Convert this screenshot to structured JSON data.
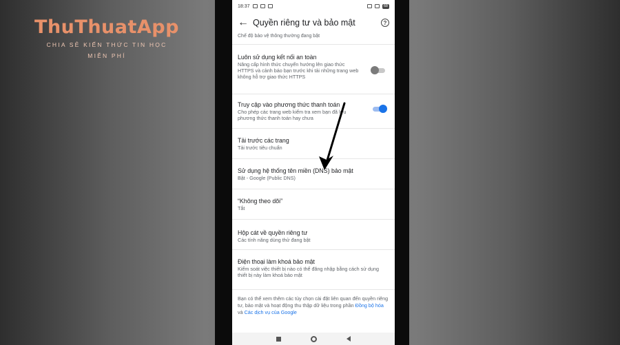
{
  "watermark": {
    "logo": "ThuThuatApp",
    "tagline_line1": "CHIA SẺ KIẾN THỨC TIN HỌC",
    "tagline_line2": "MIỄN PHÍ"
  },
  "statusbar": {
    "time": "18:37",
    "battery": "68"
  },
  "appbar": {
    "title": "Quyền riêng tư và bảo mật"
  },
  "settings": {
    "partial_top": "Chế độ bảo vệ thông thường đang bật",
    "items": [
      {
        "title": "Luôn sử dụng kết nối an toàn",
        "subtitle": "Nâng cấp hình thức chuyển hướng lên giao thức HTTPS và cảnh báo bạn trước khi tải những trang web không hỗ trợ giao thức HTTPS",
        "toggle": "off"
      },
      {
        "title": "Truy cập vào phương thức thanh toán",
        "subtitle": "Cho phép các trang web kiểm tra xem bạn đã lưu phương thức thanh toán hay chưa",
        "toggle": "on"
      },
      {
        "title": "Tải trước các trang",
        "subtitle": "Tải trước tiêu chuẩn"
      },
      {
        "title": "Sử dụng hệ thống tên miền (DNS) bảo mật",
        "subtitle": "Bật - Google (Public DNS)"
      },
      {
        "title": "“Không theo dõi”",
        "subtitle": "Tắt"
      },
      {
        "title": "Hộp cát về quyền riêng tư",
        "subtitle": "Các tính năng dùng thử đang bật"
      },
      {
        "title": "Điện thoại làm khoá bảo mật",
        "subtitle": "Kiểm soát việc thiết bị nào có thể đăng nhập bằng cách sử dụng thiết bị này làm khoá bảo mật"
      }
    ],
    "footer_note": {
      "text": "Bạn có thể xem thêm các tùy chọn cài đặt liên quan đến quyền riêng tư, bảo mật và hoạt động thu thập dữ liệu trong phần ",
      "link1": "Đồng bộ hóa",
      "between": " và ",
      "link2": "Các dịch vụ của Google"
    }
  },
  "colors": {
    "accent": "#1a73e8",
    "watermark": "#e8916a"
  }
}
